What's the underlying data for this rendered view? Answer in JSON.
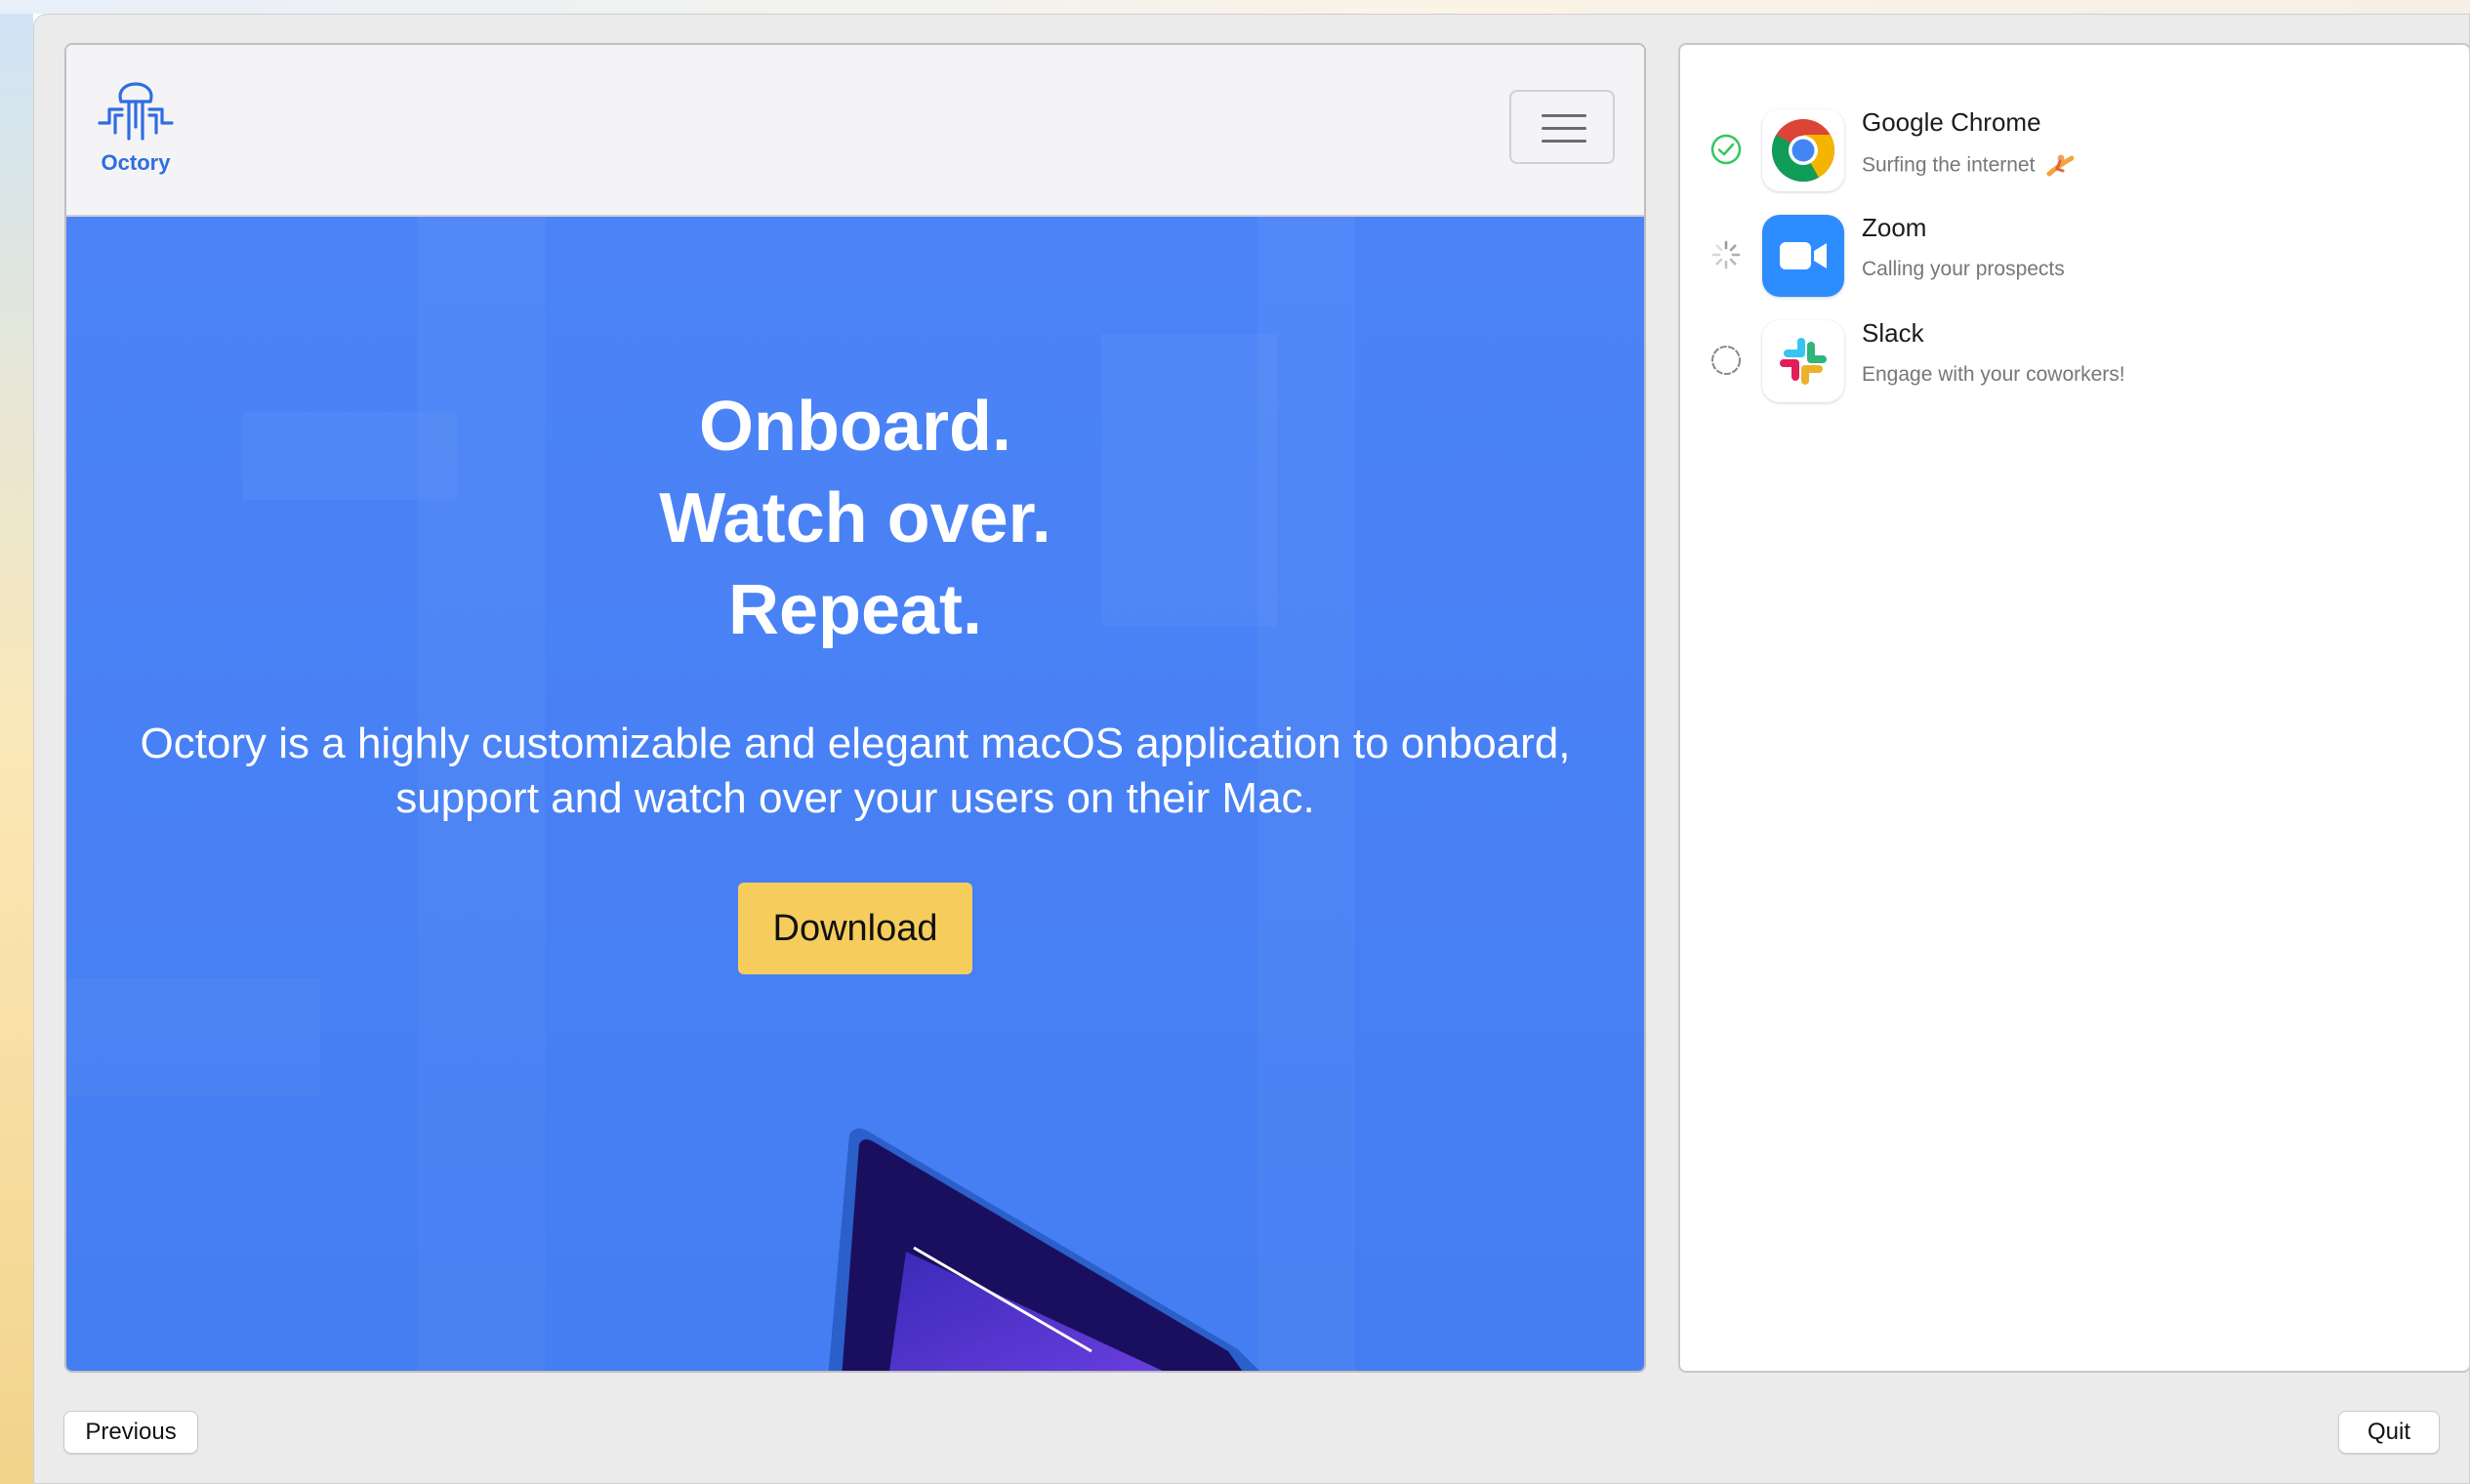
{
  "website": {
    "logo_text": "Octory",
    "menu_icon": "hamburger-menu-icon",
    "hero": {
      "title_lines": [
        "Onboard.",
        "Watch over.",
        "Repeat."
      ],
      "description": "Octory is a highly customizable and elegant macOS application to onboard, support and watch over your users on their Mac.",
      "download_label": "Download"
    }
  },
  "apps": [
    {
      "name": "Google Chrome",
      "subtitle": "Surfing the internet",
      "status": "installed",
      "icon": "chrome-icon",
      "sub_icon": "surfer-emoji-icon"
    },
    {
      "name": "Zoom",
      "subtitle": "Calling your prospects",
      "status": "installing",
      "icon": "zoom-icon"
    },
    {
      "name": "Slack",
      "subtitle": "Engage with your coworkers!",
      "status": "pending",
      "icon": "slack-icon"
    }
  ],
  "footer": {
    "previous_label": "Previous",
    "quit_label": "Quit"
  },
  "colors": {
    "hero_blue": "#4680f7",
    "download_yellow": "#f6cd5c",
    "logo_blue": "#2f6de1",
    "success_green": "#34c759"
  }
}
